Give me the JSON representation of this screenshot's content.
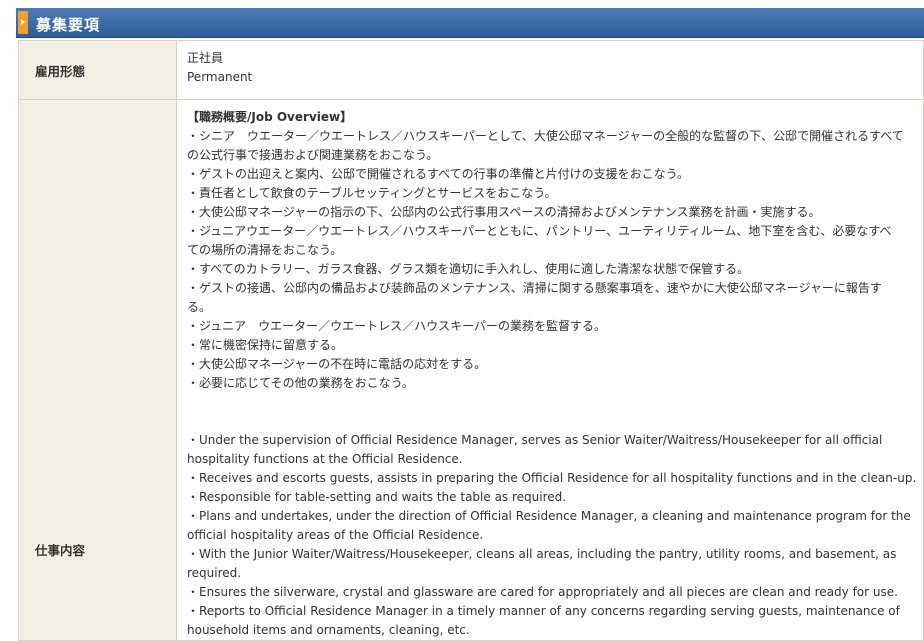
{
  "section": {
    "title": "募集要項"
  },
  "rows": {
    "employment": {
      "label": "雇用形態",
      "line1": "正社員",
      "line2": "Permanent"
    },
    "duties": {
      "label": "仕事内容",
      "heading": "【職務概要/Job Overview】",
      "ja_lines": [
        "・シニア　ウエーター／ウエートレス／ハウスキーパーとして、大使公邸マネージャーの全般的な監督の下、公邸で開催されるすべて",
        "の公式行事で接遇および関連業務をおこなう。",
        "・ゲストの出迎えと案内、公邸で開催されるすべての行事の準備と片付けの支援をおこなう。",
        "・責任者として飲食のテーブルセッティングとサービスをおこなう。",
        "・大使公邸マネージャーの指示の下、公邸内の公式行事用スペースの清掃およびメンテナンス業務を計画・実施する。",
        "・ジュニアウエーター／ウエートレス／ハウスキーパーとともに、パントリー、ユーティリティルーム、地下室を含む、必要なすべ",
        "ての場所の清掃をおこなう。",
        "・すべてのカトラリー、ガラス食器、グラス類を適切に手入れし、使用に適した清潔な状態で保管する。",
        "・ゲストの接遇、公邸内の備品および装飾品のメンテナンス、清掃に関する懸案事項を、速やかに大使公邸マネージャーに報告す",
        "る。",
        "・ジュニア　ウエーター／ウエートレス／ハウスキーパーの業務を監督する。",
        "・常に機密保持に留意する。",
        "・大使公邸マネージャーの不在時に電話の応対をする。",
        "・必要に応じてその他の業務をおこなう。"
      ],
      "en_lines": [
        "・Under the supervision of Official Residence Manager, serves as Senior Waiter/Waitress/Housekeeper for all official",
        "hospitality functions at the Official Residence.",
        "・Receives and escorts guests, assists in preparing the Official Residence for all hospitality functions and in the clean-up.",
        "・Responsible for table-setting and waits the table as required.",
        "・Plans and undertakes, under the direction of Official Residence Manager, a cleaning and maintenance program for the",
        "official hospitality areas of the Official Residence.",
        "・With the Junior Waiter/Waitress/Housekeeper, cleans all areas, including the pantry, utility rooms, and basement, as",
        "required.",
        "・Ensures the silverware, crystal and glassware are cared for appropriately and all pieces are clean and ready for use.",
        "・Reports to Official Residence Manager in a timely manner of any concerns regarding serving guests, maintenance of",
        "household items and ornaments, cleaning, etc."
      ]
    }
  },
  "colors": {
    "header": "#3a6aa8",
    "marker": "#f0a030",
    "label_bg": "#f4efe3",
    "border": "#d9d2c2"
  }
}
